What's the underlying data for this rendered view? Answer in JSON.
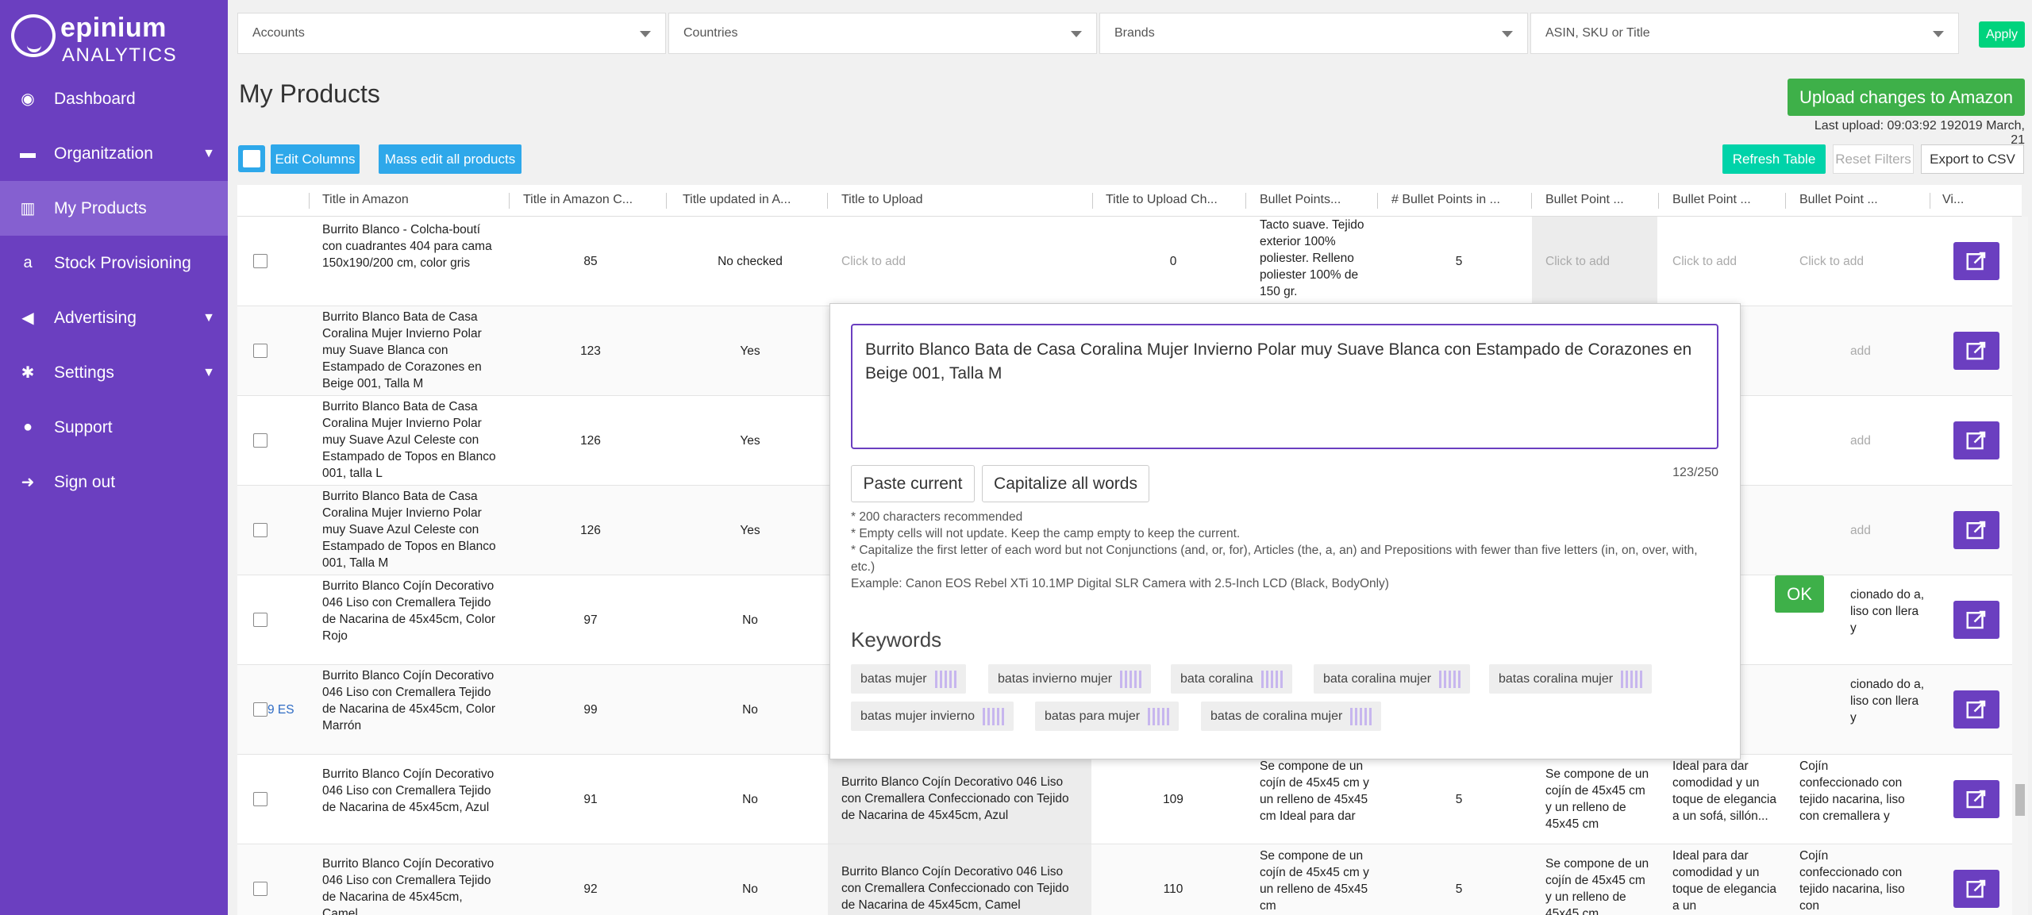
{
  "brand": {
    "name": "epinium",
    "sub": "ANALYTICS"
  },
  "sidebar": {
    "items": [
      {
        "label": "Dashboard",
        "icon": "dashboard-icon"
      },
      {
        "label": "Organitzation",
        "icon": "folder-icon",
        "has_submenu": true
      },
      {
        "label": "My Products",
        "icon": "barcode-icon",
        "active": true
      },
      {
        "label": "Stock Provisioning",
        "icon": "amazon-icon"
      },
      {
        "label": "Advertising",
        "icon": "megaphone-icon",
        "has_submenu": true
      },
      {
        "label": "Settings",
        "icon": "gear-icon",
        "has_submenu": true
      },
      {
        "label": "Support",
        "icon": "chat-icon"
      },
      {
        "label": "Sign out",
        "icon": "sign-out-icon"
      }
    ]
  },
  "filters": {
    "accounts": "Accounts",
    "countries": "Countries",
    "brands": "Brands",
    "search": "ASIN, SKU or Title",
    "apply": "Apply"
  },
  "page": {
    "title": "My Products",
    "upload_label": "Upload changes to Amazon",
    "last_upload": "Last upload: 09:03:92 192019 March, 21"
  },
  "toolbar": {
    "edit_columns": "Edit Columns",
    "mass_edit": "Mass edit all products",
    "refresh": "Refresh Table",
    "reset": "Reset Filters",
    "export": "Export to CSV"
  },
  "table": {
    "headers": [
      "Title in Amazon",
      "Title in Amazon C...",
      "Title updated in A...",
      "Title to Upload",
      "Title to Upload Ch...",
      "Bullet Points...",
      "# Bullet Points in ...",
      "Bullet Point ...",
      "Bullet Point ...",
      "Bullet Point ...",
      "Vi..."
    ],
    "rows": [
      {
        "title": "Burrito Blanco - Colcha-boutí con cuadrantes 404 para cama 150x190/200 cm, color gris",
        "count": "85",
        "updated": "No checked",
        "upload": "Click to add",
        "upload_count": "0",
        "bullets": "Tacto suave. Tejido exterior 100% poliester. Relleno poliester 100% de 150 gr.",
        "bullet_count": "5",
        "bp1": "Click to add",
        "bp2": "Click to add",
        "bp3": "Click to add"
      },
      {
        "title": "Burrito Blanco Bata de Casa Coralina Mujer Invierno Polar muy Suave Blanca con Estampado de Corazones en Beige 001, Talla M",
        "count": "123",
        "updated": "Yes",
        "bp3": "add"
      },
      {
        "title": "Burrito Blanco Bata de Casa Coralina Mujer Invierno Polar muy Suave Azul Celeste con Estampado de Topos en Blanco 001, talla L",
        "count": "126",
        "updated": "Yes",
        "bp3": "add"
      },
      {
        "title": "Burrito Blanco Bata de Casa Coralina Mujer Invierno Polar muy Suave Azul Celeste con Estampado de Topos en Blanco 001, Talla M",
        "count": "126",
        "updated": "Yes",
        "bp3": "add"
      },
      {
        "title": "Burrito Blanco Cojín Decorativo 046 Liso con Cremallera Tejido de Nacarina de 45x45cm, Color Rojo",
        "count": "97",
        "updated": "No",
        "bp3": "cionado do a, liso con llera y"
      },
      {
        "title": "Burrito Blanco Cojín Decorativo 046 Liso con Cremallera Tejido de Nacarina de 45x45cm, Color Marrón",
        "count": "99",
        "updated": "No",
        "prefix": "9 ES",
        "bp3": "cionado do a, liso con llera y"
      },
      {
        "title": "Burrito Blanco Cojín Decorativo 046 Liso con Cremallera Tejido de Nacarina de 45x45cm, Azul",
        "count": "91",
        "updated": "No",
        "upload": "Burrito Blanco Cojín Decorativo 046 Liso con Cremallera Confeccionado con Tejido de Nacarina de 45x45cm, Azul",
        "upload_count": "109",
        "bullets": "Se compone de un cojín de 45x45 cm y un relleno de 45x45 cm Ideal para dar",
        "bullet_count": "5",
        "bp1": "Se compone de un cojín de 45x45 cm y un relleno de 45x45 cm",
        "bp2": "Ideal para dar comodidad y un toque de elegancia a un sofá, sillón...",
        "bp3": "Cojín confeccionado con tejido nacarina, liso con cremallera y"
      },
      {
        "title": "Burrito Blanco Cojín Decorativo 046 Liso con Cremallera Tejido de Nacarina de 45x45cm, Camel",
        "count": "92",
        "updated": "No",
        "upload": "Burrito Blanco Cojín Decorativo 046 Liso con Cremallera Confeccionado con Tejido de Nacarina de 45x45cm, Camel",
        "upload_count": "110",
        "bullets": "Se compone de un cojín de 45x45 cm y un relleno de 45x45 cm",
        "bullet_count": "5",
        "bp1": "Se compone de un cojín de 45x45 cm y un relleno de 45x45 cm",
        "bp2": "Ideal para dar comodidad y un toque de elegancia a un",
        "bp3": "Cojín confeccionado con tejido nacarina, liso con"
      }
    ]
  },
  "modal": {
    "text": "Burrito Blanco Bata de Casa Coralina Mujer Invierno Polar muy Suave Blanca con Estampado de Corazones en Beige 001, Talla M",
    "counter": "123/250",
    "paste_current": "Paste current",
    "capitalize": "Capitalize all words",
    "notes": [
      "* 200 characters recommended",
      "* Empty cells will not update. Keep the camp empty to keep the current.",
      "* Capitalize the first letter of each word but not Conjunctions (and, or, for), Articles (the, a, an) and Prepositions with fewer than five letters (in, on, over, with, etc.)",
      "Example: Canon EOS Rebel XTi 10.1MP Digital SLR Camera with 2.5-Inch LCD (Black, BodyOnly)"
    ],
    "ok": "OK",
    "keywords_title": "Keywords",
    "keywords": [
      "batas mujer",
      "batas invierno mujer",
      "bata coralina",
      "bata coralina mujer",
      "batas coralina mujer",
      "batas mujer invierno",
      "batas para mujer",
      "batas de coralina mujer"
    ]
  },
  "watermark": "epinium",
  "colors": {
    "sidebar": "#6b3fc0",
    "sidebar_active": "#8560d0",
    "green": "#3eb049",
    "blue": "#2ea8ea",
    "teal": "#00d3a9"
  }
}
